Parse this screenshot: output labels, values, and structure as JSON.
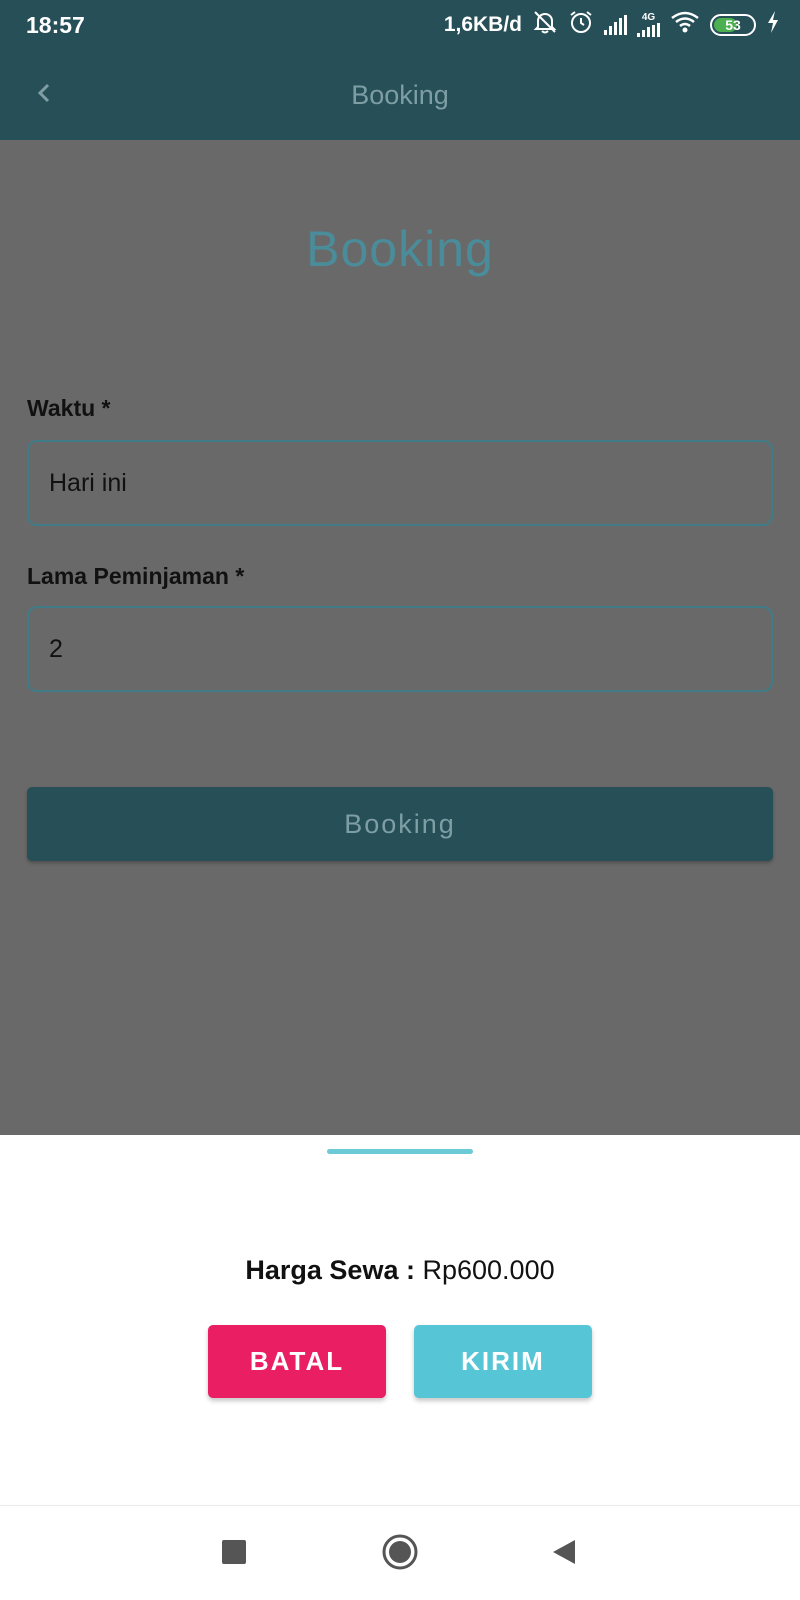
{
  "status_bar": {
    "time": "18:57",
    "network_speed": "1,6KB/d",
    "network_type": "4G",
    "battery_level": "53",
    "icons": [
      "bell-off-icon",
      "alarm-icon",
      "signal-icon",
      "signal-4g-icon",
      "wifi-icon",
      "battery-icon",
      "charging-icon"
    ]
  },
  "app_bar": {
    "title": "Booking",
    "back_icon": "chevron-left-icon"
  },
  "form": {
    "heading": "Booking",
    "waktu_label": "Waktu *",
    "waktu_value": "Hari ini",
    "lama_label": "Lama Peminjaman *",
    "lama_value": "2",
    "submit_label": "Booking"
  },
  "bottom_sheet": {
    "price_label": "Harga Sewa :",
    "price_value": "Rp600.000",
    "cancel_label": "BATAL",
    "submit_label": "KIRIM"
  },
  "nav_bar": {
    "icons": [
      "recents-square-icon",
      "home-circle-icon",
      "back-triangle-icon"
    ]
  },
  "colors": {
    "primary_dimmed": "#264f57",
    "scrim_content": "#696969",
    "accent_cyan": "#56c5d6",
    "cancel_pink": "#e91e63"
  }
}
